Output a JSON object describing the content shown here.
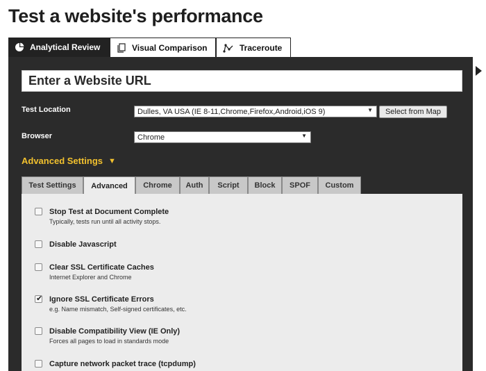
{
  "page": {
    "title": "Test a website's performance"
  },
  "main_tabs": [
    {
      "label": "Analytical Review",
      "icon": "gauge-icon",
      "active": true
    },
    {
      "label": "Visual Comparison",
      "icon": "documents-icon",
      "active": false
    },
    {
      "label": "Traceroute",
      "icon": "traceroute-icon",
      "active": false
    }
  ],
  "form": {
    "url_placeholder": "Enter a Website URL",
    "location_label": "Test Location",
    "location_value": "Dulles, VA USA (IE 8-11,Chrome,Firefox,Android,iOS 9)",
    "map_button": "Select from Map",
    "browser_label": "Browser",
    "browser_value": "Chrome",
    "advanced_label": "Advanced Settings",
    "advanced_toggle_icon": "▼"
  },
  "settings_tabs": [
    "Test Settings",
    "Advanced",
    "Chrome",
    "Auth",
    "Script",
    "Block",
    "SPOF",
    "Custom"
  ],
  "active_settings_tab": "Advanced",
  "options": [
    {
      "title": "Stop Test at Document Complete",
      "desc": "Typically, tests run until all activity stops.",
      "checked": false
    },
    {
      "title": "Disable Javascript",
      "desc": "",
      "checked": false
    },
    {
      "title": "Clear SSL Certificate Caches",
      "desc": "Internet Explorer and Chrome",
      "checked": false
    },
    {
      "title": "Ignore SSL Certificate Errors",
      "desc": "e.g. Name mismatch, Self-signed certificates, etc.",
      "checked": true
    },
    {
      "title": "Disable Compatibility View (IE Only)",
      "desc": "Forces all pages to load in standards mode",
      "checked": false
    },
    {
      "title": "Capture network packet trace (tcpdump)",
      "desc": "",
      "checked": false
    }
  ],
  "colors": {
    "panel": "#2b2b2b",
    "accent": "#f2c12e",
    "settings_bg": "#ececec"
  }
}
